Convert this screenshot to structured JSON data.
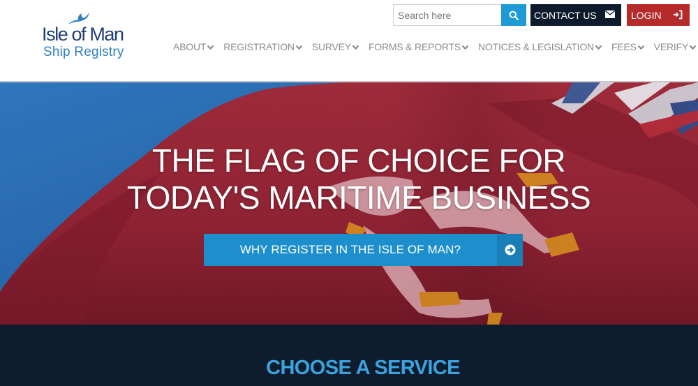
{
  "logo": {
    "line1": "Isle of Man",
    "line2": "Ship Registry",
    "icon": "bird-logo-icon"
  },
  "search": {
    "placeholder": "Search here",
    "value": "",
    "icon": "search-icon"
  },
  "header_buttons": {
    "contact": {
      "label": "CONTACT US",
      "icon": "envelope-icon"
    },
    "login": {
      "label": "LOGIN",
      "icon": "sign-in-icon"
    }
  },
  "nav": {
    "items": [
      {
        "label": "ABOUT"
      },
      {
        "label": "REGISTRATION"
      },
      {
        "label": "SURVEY"
      },
      {
        "label": "FORMS & REPORTS"
      },
      {
        "label": "NOTICES & LEGISLATION"
      },
      {
        "label": "FEES"
      },
      {
        "label": "VERIFY"
      }
    ],
    "chevron_icon": "chevron-down-icon"
  },
  "hero": {
    "title_line1": "THE FLAG OF CHOICE FOR",
    "title_line2": "TODAY'S MARITIME BUSINESS",
    "cta_label": "WHY REGISTER IN THE ISLE OF MAN?",
    "cta_icon": "circle-arrow-right-icon"
  },
  "services": {
    "title": "CHOOSE A SERVICE"
  },
  "colors": {
    "brand_navy": "#1f3d73",
    "brand_blue": "#2f7fc4",
    "accent_blue": "#1e9ad6",
    "contact_bg": "#0d1a2b",
    "login_red": "#b52a2a",
    "services_bg": "#0f1c2e",
    "services_title": "#3aa3dd"
  }
}
